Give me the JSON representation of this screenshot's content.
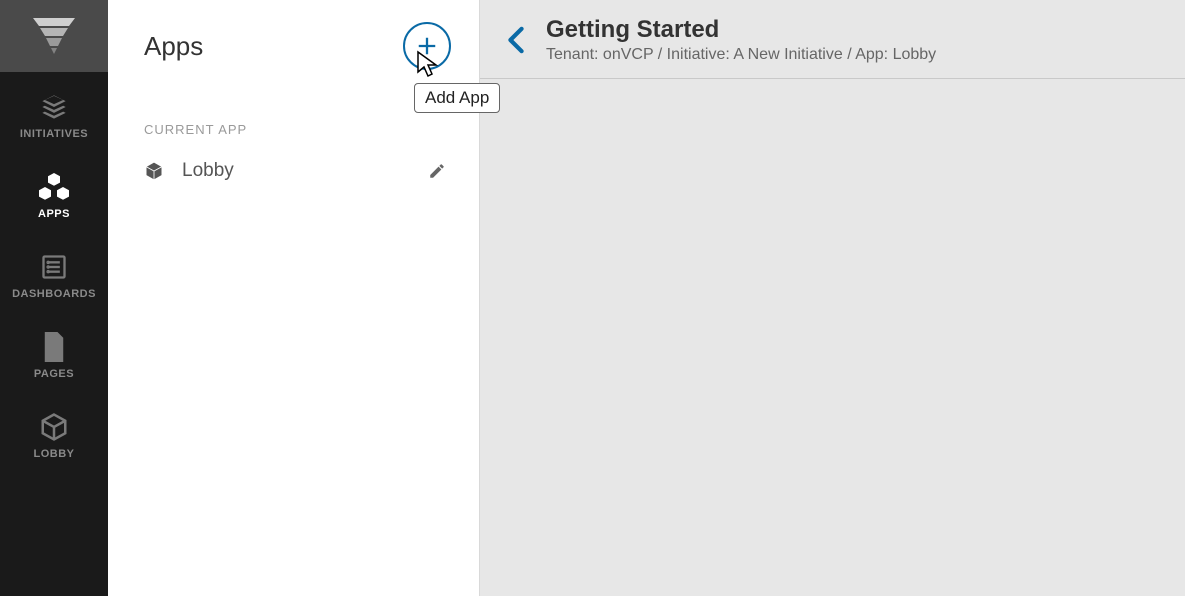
{
  "nav": {
    "items": [
      {
        "label": "INITIATIVES"
      },
      {
        "label": "APPS"
      },
      {
        "label": "DASHBOARDS"
      },
      {
        "label": "PAGES"
      },
      {
        "label": "LOBBY"
      }
    ]
  },
  "panel": {
    "title": "Apps",
    "section_label": "CURRENT APP",
    "current_app": {
      "name": "Lobby"
    }
  },
  "main": {
    "title": "Getting Started",
    "breadcrumb": "Tenant: onVCP / Initiative: A New Initiative / App: Lobby"
  },
  "tooltip": {
    "add_app": "Add App"
  }
}
